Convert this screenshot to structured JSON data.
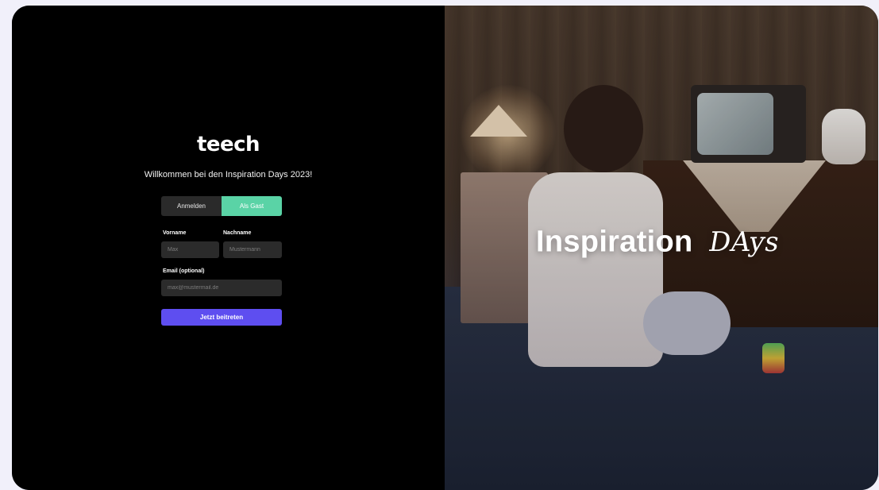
{
  "brand": {
    "name": "teech"
  },
  "welcome": {
    "text": "Willkommen bei den Inspiration Days 2023!"
  },
  "toggle": {
    "login_label": "Anmelden",
    "guest_label": "Als Gast",
    "active": "guest"
  },
  "form": {
    "first_name_label": "Vorname",
    "first_name_placeholder": "Max",
    "last_name_label": "Nachname",
    "last_name_placeholder": "Mustermann",
    "email_label": "Email (optional)",
    "email_placeholder": "max@mustermail.de",
    "submit_label": "Jetzt beitreten"
  },
  "hero": {
    "title_main": "Inspiration",
    "title_accent": "DAys"
  },
  "colors": {
    "accent_green": "#5ad3a6",
    "primary_purple": "#5e4ef0",
    "panel_background": "#000000",
    "page_background": "#f1f0fa"
  }
}
